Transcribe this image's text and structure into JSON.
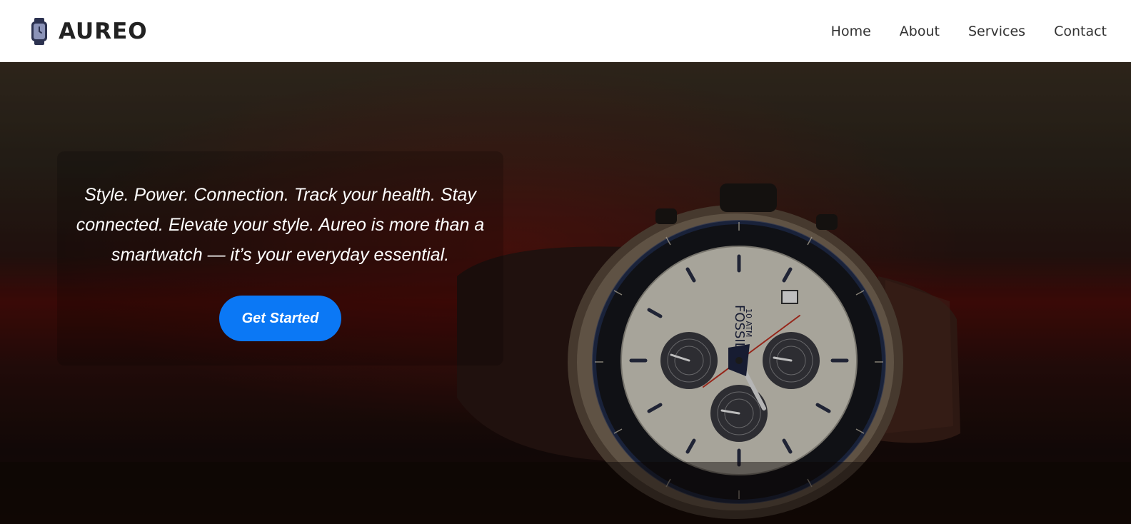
{
  "brand": {
    "name": "AUREO",
    "icon": "smartwatch-icon"
  },
  "nav": {
    "items": [
      {
        "label": "Home"
      },
      {
        "label": "About"
      },
      {
        "label": "Services"
      },
      {
        "label": "Contact"
      }
    ]
  },
  "hero": {
    "tagline": "Style. Power. Connection. Track your health. Stay connected. Elevate your style. Aureo is more than a smartwatch — it’s your everyday essential.",
    "cta_label": "Get Started",
    "watch_logo": "FOSSIL",
    "watch_sublogo": "10 ATM"
  },
  "colors": {
    "accent": "#0b78f5",
    "nav_bg": "#ffffff",
    "text_dark": "#222222"
  }
}
